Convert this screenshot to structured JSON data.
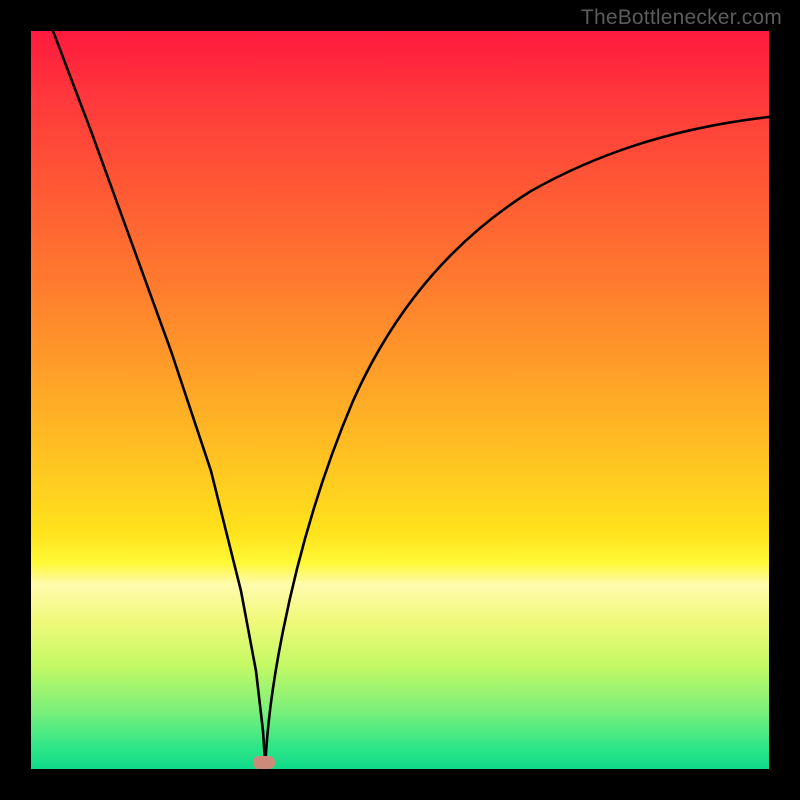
{
  "attribution": "TheBottlenecker.com",
  "chart_data": {
    "type": "line",
    "title": "",
    "xlabel": "",
    "ylabel": "",
    "xlim": [
      0,
      100
    ],
    "ylim": [
      0,
      100
    ],
    "curve_description": "V-shaped bottleneck curve with minimum near x≈32. Left branch descends steeply from top-left; right branch rises asymptotically toward upper-right.",
    "minimum_x": 32,
    "minimum_y": 0,
    "left_branch": [
      {
        "x": 3,
        "y": 100
      },
      {
        "x": 10,
        "y": 75
      },
      {
        "x": 17,
        "y": 50
      },
      {
        "x": 24,
        "y": 25
      },
      {
        "x": 31,
        "y": 2
      },
      {
        "x": 32,
        "y": 0
      }
    ],
    "right_branch": [
      {
        "x": 32,
        "y": 0
      },
      {
        "x": 35,
        "y": 12
      },
      {
        "x": 40,
        "y": 30
      },
      {
        "x": 48,
        "y": 48
      },
      {
        "x": 60,
        "y": 62
      },
      {
        "x": 75,
        "y": 72
      },
      {
        "x": 90,
        "y": 78
      },
      {
        "x": 100,
        "y": 80
      }
    ],
    "marker": {
      "x": 32,
      "y": 0,
      "color": "#cc8b7a"
    },
    "background_gradient": {
      "top": "#ff1a3e",
      "mid": "#ffe31c",
      "bottom": "#0fd989"
    }
  }
}
